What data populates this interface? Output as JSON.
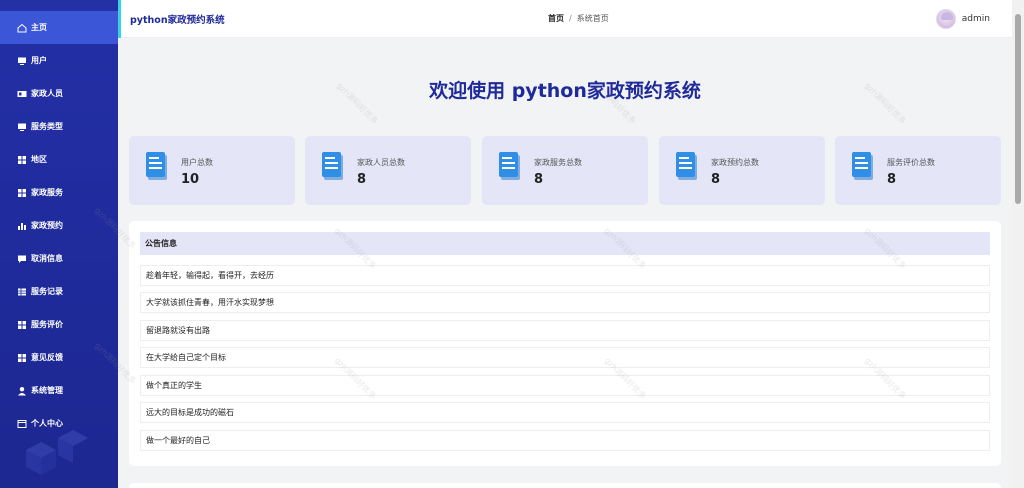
{
  "app": {
    "title": "python家政预约系统",
    "welcome": "欢迎使用 python家政预约系统"
  },
  "breadcrumb": {
    "home": "首页",
    "separator": "/",
    "current": "系统首页"
  },
  "user": {
    "name": "admin"
  },
  "sidebar": {
    "items": [
      {
        "label": "主页",
        "icon": "home-icon"
      },
      {
        "label": "用户",
        "icon": "monitor-icon"
      },
      {
        "label": "家政人员",
        "icon": "card-icon"
      },
      {
        "label": "服务类型",
        "icon": "monitor-icon"
      },
      {
        "label": "地区",
        "icon": "grid-icon"
      },
      {
        "label": "家政服务",
        "icon": "grid-icon"
      },
      {
        "label": "家政预约",
        "icon": "bar-chart-icon"
      },
      {
        "label": "取消信息",
        "icon": "message-icon"
      },
      {
        "label": "服务记录",
        "icon": "table-icon"
      },
      {
        "label": "服务评价",
        "icon": "grid-icon"
      },
      {
        "label": "意见反馈",
        "icon": "grid-icon"
      },
      {
        "label": "系统管理",
        "icon": "user-icon"
      },
      {
        "label": "个人中心",
        "icon": "window-icon"
      }
    ]
  },
  "stats": [
    {
      "label": "用户总数",
      "value": "10"
    },
    {
      "label": "家政人员总数",
      "value": "8"
    },
    {
      "label": "家政服务总数",
      "value": "8"
    },
    {
      "label": "家政预约总数",
      "value": "8"
    },
    {
      "label": "服务评价总数",
      "value": "8"
    }
  ],
  "notices": {
    "title": "公告信息",
    "items": [
      "趁着年轻，输得起，看得开，去经历",
      "大学就该抓住青春，用汗水实现梦想",
      "留退路就没有出路",
      "在大学给自己定个目标",
      "做个真正的学生",
      "远大的目标是成功的磁石",
      "做一个最好的自己"
    ]
  },
  "watermark": "gzh源码好优多",
  "colors": {
    "sidebar": "#2330a6",
    "active": "#3b56d6",
    "accent": "#34d3e6",
    "card": "#e4e6f7",
    "title": "#1f2a9a"
  }
}
